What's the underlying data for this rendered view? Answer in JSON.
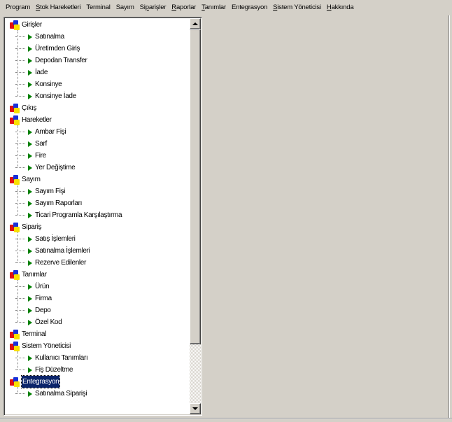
{
  "menu": [
    {
      "pre": "Program",
      "u": "",
      "post": ""
    },
    {
      "pre": "",
      "u": "S",
      "post": "tok Hareketleri"
    },
    {
      "pre": "Terminal",
      "u": "",
      "post": ""
    },
    {
      "pre": "Sayım",
      "u": "",
      "post": ""
    },
    {
      "pre": "Si",
      "u": "p",
      "post": "arişler"
    },
    {
      "pre": "",
      "u": "R",
      "post": "aporlar"
    },
    {
      "pre": "",
      "u": "T",
      "post": "anımlar"
    },
    {
      "pre": "Entegrasyon",
      "u": "",
      "post": ""
    },
    {
      "pre": "",
      "u": "S",
      "post": "istem Yöneticisi"
    },
    {
      "pre": "",
      "u": "H",
      "post": "akkında"
    }
  ],
  "tree": [
    {
      "label": "Girişler",
      "level": 0
    },
    {
      "label": "Satınalma",
      "level": 1
    },
    {
      "label": "Üretimden Giriş",
      "level": 1
    },
    {
      "label": "Depodan Transfer",
      "level": 1
    },
    {
      "label": "İade",
      "level": 1
    },
    {
      "label": "Konsinye",
      "level": 1
    },
    {
      "label": "Konsinye İade",
      "level": 1
    },
    {
      "label": "Çıkış",
      "level": 0
    },
    {
      "label": "Hareketler",
      "level": 0
    },
    {
      "label": "Ambar Fişi",
      "level": 1
    },
    {
      "label": "Sarf",
      "level": 1
    },
    {
      "label": "Fire",
      "level": 1
    },
    {
      "label": "Yer Değiştime",
      "level": 1
    },
    {
      "label": "Sayım",
      "level": 0
    },
    {
      "label": "Sayım Fişi",
      "level": 1
    },
    {
      "label": "Sayım Raporları",
      "level": 1
    },
    {
      "label": "Ticari Programla Karşılaştırma",
      "level": 1
    },
    {
      "label": "Sipariş",
      "level": 0
    },
    {
      "label": "Satış İşlemleri",
      "level": 1
    },
    {
      "label": "Satınalma İşlemleri",
      "level": 1
    },
    {
      "label": "Rezerve Edilenler",
      "level": 1
    },
    {
      "label": "Tanımlar",
      "level": 0
    },
    {
      "label": "Ürün",
      "level": 1
    },
    {
      "label": "Firma",
      "level": 1
    },
    {
      "label": "Depo",
      "level": 1
    },
    {
      "label": "Özel Kod",
      "level": 1
    },
    {
      "label": "Terminal",
      "level": 0
    },
    {
      "label": "Sistem Yöneticisi",
      "level": 0
    },
    {
      "label": "Kullanıcı Tanımları",
      "level": 1
    },
    {
      "label": "Fiş Düzeltme",
      "level": 1
    },
    {
      "label": "Entegrasyon",
      "level": 0,
      "selected": true
    },
    {
      "label": "Satınalma Siparişi",
      "level": 1
    }
  ],
  "colors": {
    "window_bg": "#d4d0c8",
    "tree_bg": "#ffffff",
    "selection": "#0a246a",
    "arrow": "#008000"
  },
  "icons": {
    "root": "red-blue-yellow-blocks-icon",
    "child": "green-arrow-icon"
  },
  "scrollbar": {
    "position_fraction": 0.0
  }
}
